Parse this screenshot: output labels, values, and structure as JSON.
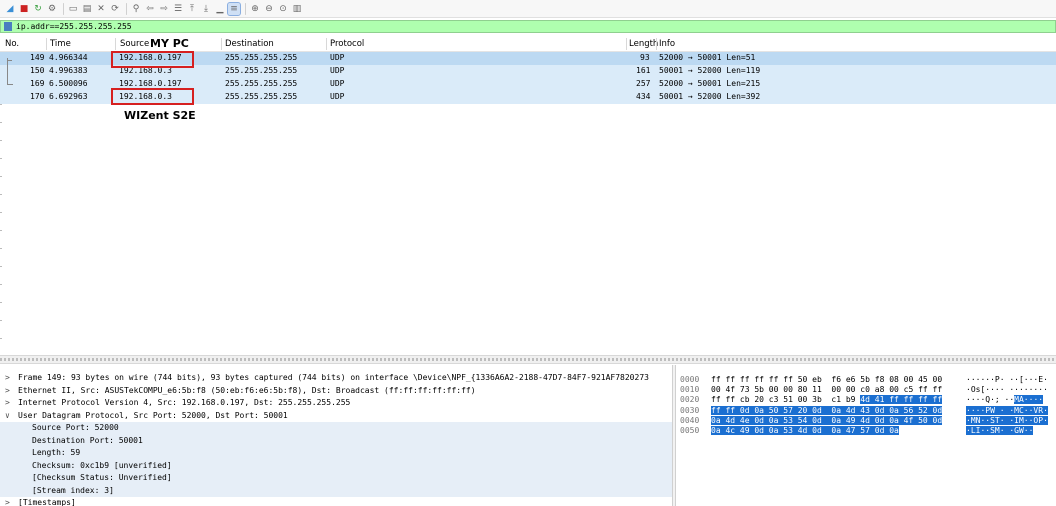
{
  "toolbar": {
    "buttons": [
      {
        "name": "shark-fin-icon",
        "glyph": "◢"
      },
      {
        "name": "stop-icon",
        "glyph": "■"
      },
      {
        "name": "restart-icon",
        "glyph": "↻"
      },
      {
        "name": "options-gear-icon",
        "glyph": "⚙"
      },
      {
        "name": "sep"
      },
      {
        "name": "open-file-icon",
        "glyph": "▭"
      },
      {
        "name": "save-file-icon",
        "glyph": "▤"
      },
      {
        "name": "close-file-icon",
        "glyph": "✕"
      },
      {
        "name": "reload-icon",
        "glyph": "⟳"
      },
      {
        "name": "sep"
      },
      {
        "name": "find-icon",
        "glyph": "⚲"
      },
      {
        "name": "back-icon",
        "glyph": "⇦"
      },
      {
        "name": "forward-icon",
        "glyph": "⇨"
      },
      {
        "name": "go-to-packet-icon",
        "glyph": "☰"
      },
      {
        "name": "first-packet-icon",
        "glyph": "⤒"
      },
      {
        "name": "last-packet-icon",
        "glyph": "⤓"
      },
      {
        "name": "auto-scroll-icon",
        "glyph": "▁"
      },
      {
        "name": "colorize-icon",
        "glyph": "≡"
      },
      {
        "name": "sep"
      },
      {
        "name": "zoom-in-icon",
        "glyph": "⊕"
      },
      {
        "name": "zoom-out-icon",
        "glyph": "⊖"
      },
      {
        "name": "zoom-normal-icon",
        "glyph": "⊙"
      },
      {
        "name": "resize-columns-icon",
        "glyph": "▥"
      }
    ]
  },
  "filter": {
    "value": "ip.addr==255.255.255.255"
  },
  "columns": [
    "No.",
    "Time",
    "Source",
    "Destination",
    "Protocol",
    "Length",
    "Info"
  ],
  "packets": [
    {
      "no": "149",
      "time": "4.966344",
      "src": "192.168.0.197",
      "dst": "255.255.255.255",
      "proto": "UDP",
      "len": "93",
      "info": "52000 → 50001 Len=51"
    },
    {
      "no": "150",
      "time": "4.996383",
      "src": "192.168.0.3",
      "dst": "255.255.255.255",
      "proto": "UDP",
      "len": "161",
      "info": "50001 → 52000 Len=119"
    },
    {
      "no": "169",
      "time": "6.500096",
      "src": "192.168.0.197",
      "dst": "255.255.255.255",
      "proto": "UDP",
      "len": "257",
      "info": "52000 → 50001 Len=215"
    },
    {
      "no": "170",
      "time": "6.692963",
      "src": "192.168.0.3",
      "dst": "255.255.255.255",
      "proto": "UDP",
      "len": "434",
      "info": "50001 → 52000 Len=392"
    }
  ],
  "annotations": {
    "top": "MY PC",
    "bottom": "WIZent S2E"
  },
  "details": [
    {
      "arrow": ">",
      "text": "Frame 149: 93 bytes on wire (744 bits), 93 bytes captured (744 bits) on interface \\Device\\NPF_{1336A6A2-2188-47D7-84F7-921AF7820273"
    },
    {
      "arrow": ">",
      "text": "Ethernet II, Src: ASUSTekCOMPU_e6:5b:f8 (50:eb:f6:e6:5b:f8), Dst: Broadcast (ff:ff:ff:ff:ff:ff)"
    },
    {
      "arrow": ">",
      "text": "Internet Protocol Version 4, Src: 192.168.0.197, Dst: 255.255.255.255"
    },
    {
      "arrow": "∨",
      "text": "User Datagram Protocol, Src Port: 52000, Dst Port: 50001"
    },
    {
      "arrow": "",
      "text": "Source Port: 52000"
    },
    {
      "arrow": "",
      "text": "Destination Port: 50001"
    },
    {
      "arrow": "",
      "text": "Length: 59"
    },
    {
      "arrow": "",
      "text": "Checksum: 0xc1b9 [unverified]"
    },
    {
      "arrow": "",
      "text": "[Checksum Status: Unverified]"
    },
    {
      "arrow": "",
      "text": "[Stream index: 3]"
    },
    {
      "arrow": ">",
      "text": "[Timestamps]"
    }
  ],
  "bytes": {
    "offsets": [
      "0000",
      "0010",
      "0020",
      "0030",
      "0040",
      "0050"
    ],
    "hex_plain": [
      "ff ff ff ff ff ff 50 eb  f6 e6 5b f8 08 00 45 00",
      "00 4f 73 5b 00 00 80 11  00 00 c0 a8 00 c5 ff ff",
      "ff ff cb 20 c3 51 00 3b  c1 b9 ",
      "",
      "",
      ""
    ],
    "hex_hl": [
      "",
      "",
      "4d 41 ff ff ff ff",
      "ff ff 0d 0a 50 57 20 0d  0a 4d 43 0d 0a 56 52 0d",
      "0a 4d 4e 0d 0a 53 54 0d  0a 49 4d 0d 0a 4f 50 0d",
      "0a 4c 49 0d 0a 53 4d 0d  0a 47 57 0d 0a"
    ],
    "ascii_plain": [
      "······P· ··[···E·",
      "·Os[···· ········",
      "····Q·; ··",
      "",
      "",
      ""
    ],
    "ascii_hl": [
      "",
      "",
      "MA····",
      "····PW · ·MC··VR·",
      "·MN··ST· ·IM··OP·",
      "·LI··SM· ·GW··"
    ]
  }
}
